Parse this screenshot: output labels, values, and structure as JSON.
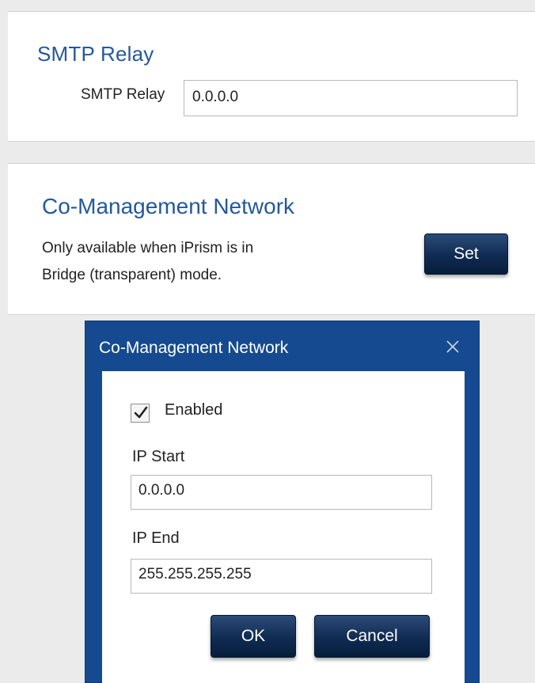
{
  "smtp": {
    "title": "SMTP Relay",
    "field_label": "SMTP Relay",
    "field_value": "0.0.0.0"
  },
  "comanagement": {
    "title": "Co-Management Network",
    "description_line1": "Only available when iPrism is in",
    "description_line2": "Bridge (transparent) mode.",
    "set_label": "Set"
  },
  "dialog": {
    "title": "Co-Management Network",
    "close_icon": "close-icon",
    "enabled_label": "Enabled",
    "enabled_checked": true,
    "ip_start_label": "IP Start",
    "ip_start_value": "0.0.0.0",
    "ip_end_label": "IP End",
    "ip_end_value": "255.255.255.255",
    "ok_label": "OK",
    "cancel_label": "Cancel"
  },
  "colors": {
    "heading": "#24589c",
    "dialog_frame": "#164a90",
    "button": "#0f2b52",
    "background": "#ebebeb"
  }
}
